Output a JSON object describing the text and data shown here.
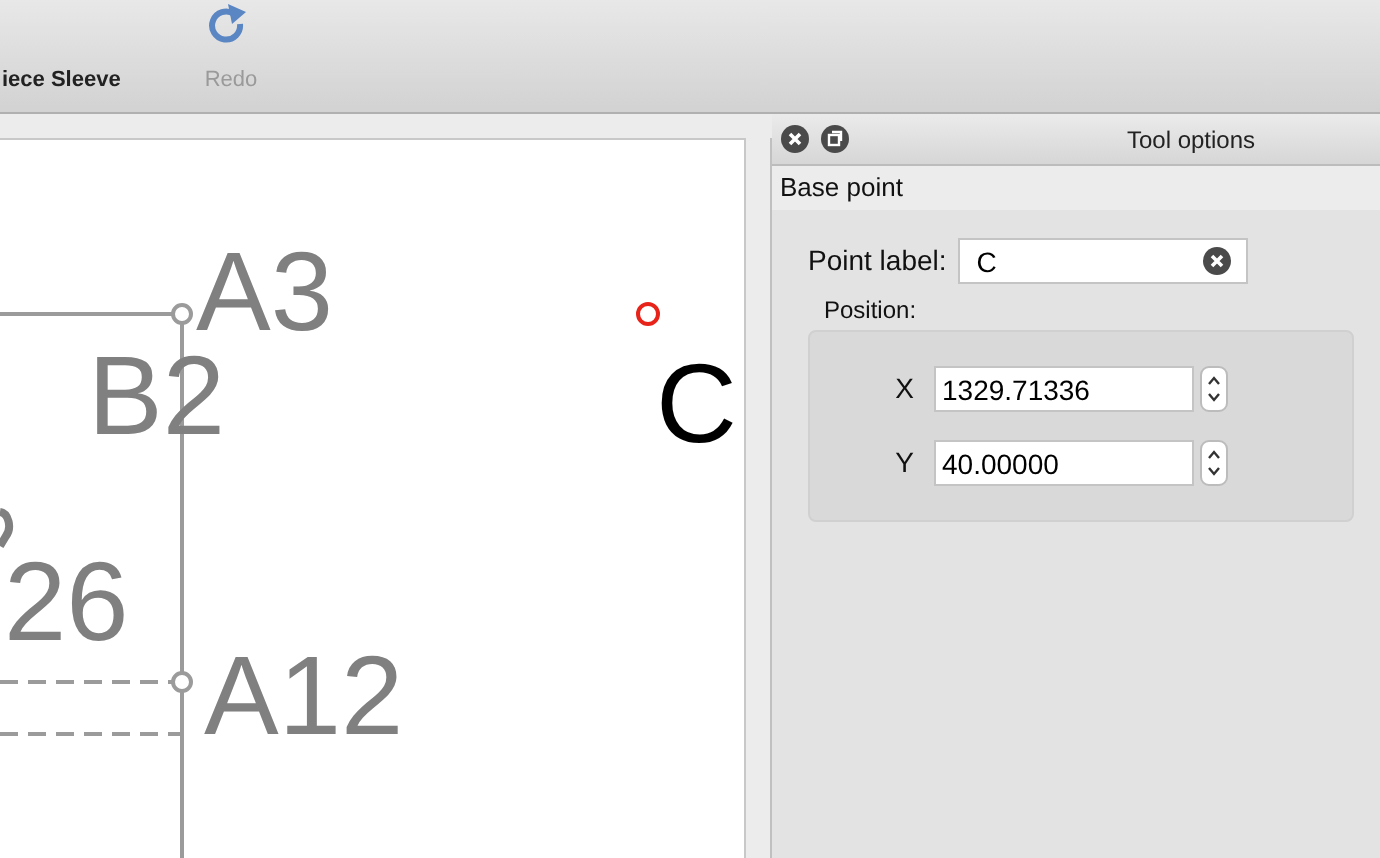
{
  "toolbar": {
    "items": [
      {
        "label": "iece Sleeve",
        "disabled": false
      },
      {
        "label": "Redo",
        "disabled": true
      }
    ]
  },
  "canvas": {
    "labels": [
      {
        "text": "A3",
        "kind": "piece"
      },
      {
        "text": "B2",
        "kind": "piece"
      },
      {
        "text": "26",
        "kind": "piece"
      },
      {
        "text": "A12",
        "kind": "piece"
      },
      {
        "text": "C",
        "kind": "point"
      }
    ]
  },
  "tool_options": {
    "title": "Tool options",
    "section": "Base point",
    "point_label": {
      "label": "Point label:",
      "value": "C"
    },
    "position": {
      "label": "Position:",
      "fields": [
        {
          "label": "X",
          "value": "1329.71336"
        },
        {
          "label": "Y",
          "value": "40.00000"
        }
      ]
    }
  }
}
